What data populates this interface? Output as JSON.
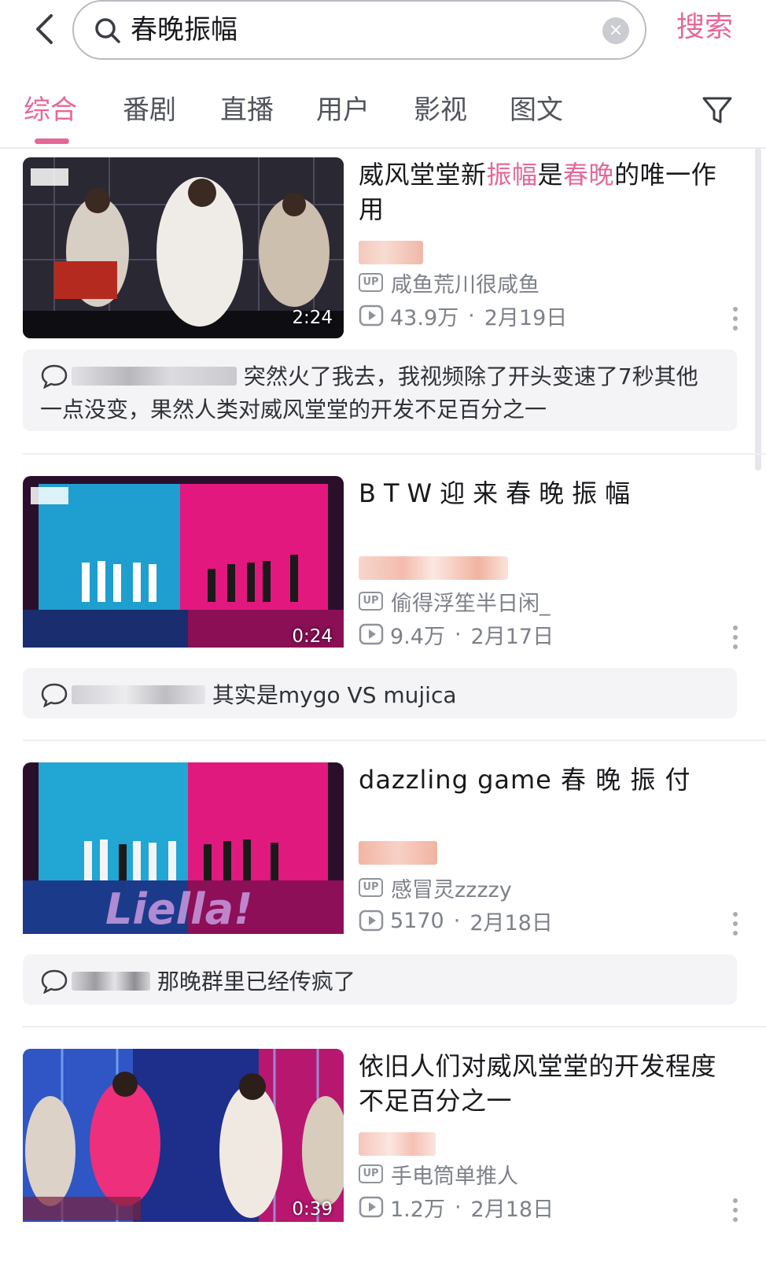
{
  "search": {
    "query": "春晚振幅",
    "button_label": "搜索"
  },
  "tabs": [
    {
      "label": "综合",
      "active": true
    },
    {
      "label": "番剧",
      "active": false
    },
    {
      "label": "直播",
      "active": false
    },
    {
      "label": "用户",
      "active": false
    },
    {
      "label": "影视",
      "active": false
    },
    {
      "label": "图文",
      "active": false
    }
  ],
  "colors": {
    "accent": "#e5689a",
    "text_primary": "#18191c",
    "text_secondary": "#7d8188",
    "comment_bg": "#f4f4f6"
  },
  "icons": {
    "back": "chevron-left-icon",
    "search": "search-icon",
    "clear": "clear-icon",
    "filter": "filter-icon",
    "up": "up-badge-icon",
    "play": "play-count-icon",
    "more": "more-vertical-icon",
    "comment": "comment-icon"
  },
  "results": [
    {
      "title_parts": [
        {
          "text": "威风堂堂新",
          "highlight": false
        },
        {
          "text": "振幅",
          "highlight": true
        },
        {
          "text": "是",
          "highlight": false
        },
        {
          "text": "春晚",
          "highlight": true
        },
        {
          "text": "的唯一作用",
          "highlight": false
        }
      ],
      "duration": "2:24",
      "uploader": "咸鱼荒川很咸鱼",
      "up_badge": "UP",
      "views": "43.9万",
      "date": "2月19日",
      "comment": "突然火了我去，我视频除了开头变速了7秒其他一点没变，果然人类对威风堂堂的开发不足百分之一"
    },
    {
      "title_parts": [
        {
          "text": "BTW迎来春晚振幅",
          "highlight": false
        }
      ],
      "duration": "0:24",
      "uploader": "偷得浮笙半日闲_",
      "up_badge": "UP",
      "views": "9.4万",
      "date": "2月17日",
      "comment": "其实是mygo VS mujica"
    },
    {
      "title_parts": [
        {
          "text": "dazzling game 春 晚 振 付",
          "highlight": false
        }
      ],
      "duration": "",
      "uploader": "感冒灵zzzzy",
      "up_badge": "UP",
      "views": "5170",
      "date": "2月18日",
      "comment": "那晚群里已经传疯了"
    },
    {
      "title_parts": [
        {
          "text": "依旧人们对威风堂堂的开发程度不足百分之一",
          "highlight": false
        }
      ],
      "duration": "0:39",
      "uploader": "手电筒单推人",
      "up_badge": "UP",
      "views": "1.2万",
      "date": "2月18日"
    }
  ]
}
